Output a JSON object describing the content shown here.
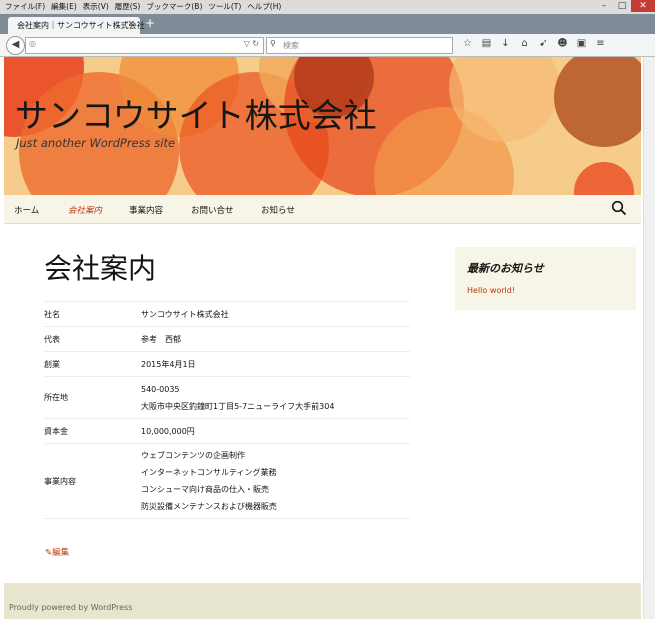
{
  "browser": {
    "menu": [
      "ファイル(F)",
      "編集(E)",
      "表示(V)",
      "履歴(S)",
      "ブックマーク(B)",
      "ツール(T)",
      "ヘルプ(H)"
    ],
    "tab_title": "会社案内｜サンコウサイト株式会社",
    "tab_close": "×",
    "new_tab": "+",
    "search_placeholder": "検索",
    "window_buttons": [
      "–",
      "□",
      "✕"
    ]
  },
  "site": {
    "title": "サンコウサイト株式会社",
    "description": "Just another WordPress site"
  },
  "nav": {
    "items": [
      {
        "label": "ホーム",
        "active": false
      },
      {
        "label": "会社案内",
        "active": true
      },
      {
        "label": "事業内容",
        "active": false
      },
      {
        "label": "お問い合せ",
        "active": false
      },
      {
        "label": "お知らせ",
        "active": false
      }
    ]
  },
  "page": {
    "title": "会社案内",
    "rows": [
      {
        "key": "社名",
        "values": [
          "サンコウサイト株式会社"
        ]
      },
      {
        "key": "代表",
        "values": [
          "参考　西郁"
        ]
      },
      {
        "key": "創業",
        "values": [
          "2015年4月1日"
        ]
      },
      {
        "key": "所在地",
        "values": [
          "540-0035",
          "大阪市中央区釣鐘町1丁目5-7ニューライフ大手前304"
        ]
      },
      {
        "key": "資本金",
        "values": [
          "10,000,000円"
        ]
      },
      {
        "key": "事業内容",
        "values": [
          "ウェブコンテンツの企画制作",
          "インターネットコンサルティング業務",
          "コンシューマ向け商品の仕入・販売",
          "防災設備メンテナンスおよび機器販売"
        ]
      }
    ],
    "edit_label": "編集"
  },
  "sidebar": {
    "widget_title": "最新のお知らせ",
    "link": "Hello world!"
  },
  "footer": {
    "text": "Proudly powered by WordPress"
  },
  "colors": {
    "accent": "#bc360a",
    "nav_bg": "#f7f5e7",
    "footer_bg": "#e8e5ce",
    "header_bg": "#f4c37e"
  }
}
